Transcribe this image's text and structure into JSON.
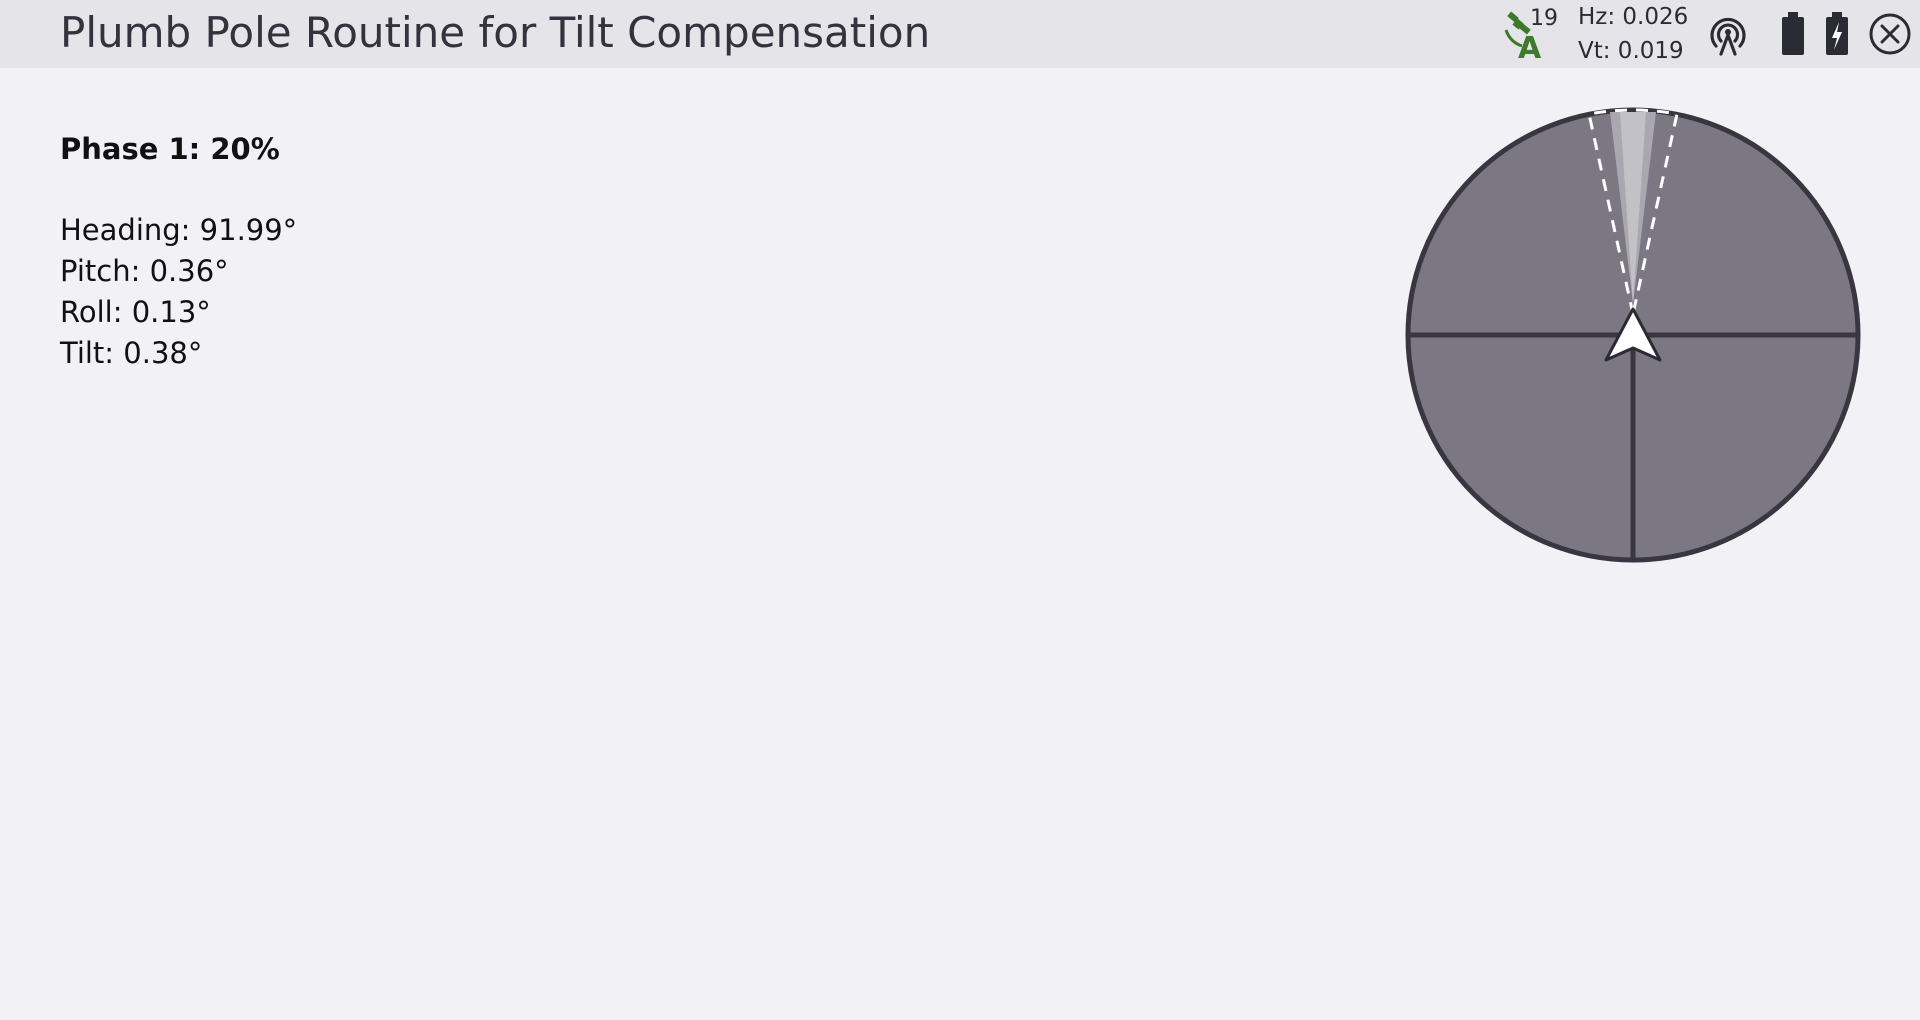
{
  "header": {
    "title": "Plumb Pole Routine for Tilt Compensation",
    "satellite_count": "19",
    "satellite_icon": "satellite-autonomous-icon",
    "hz_precision": "Hz: 0.026",
    "vt_precision": "Vt: 0.019",
    "radio_icon": "radio-signal-icon",
    "controller_battery_icon": "battery-icon",
    "receiver_battery_icon": "battery-charging-icon",
    "close_icon": "close-icon"
  },
  "phase": {
    "label": "Phase 1: 20%",
    "progress_percent": 20
  },
  "readings": {
    "heading": "Heading: 91.99°",
    "pitch": "Pitch: 0.36°",
    "roll": "Roll: 0.13°",
    "tilt": "Tilt: 0.38°"
  },
  "colors": {
    "header_bg": "#e4e4e9",
    "page_bg": "#f2f2f6",
    "dial_fill": "#7b7884",
    "dial_stroke": "#38363f",
    "sat_green": "#3c7a2c"
  }
}
